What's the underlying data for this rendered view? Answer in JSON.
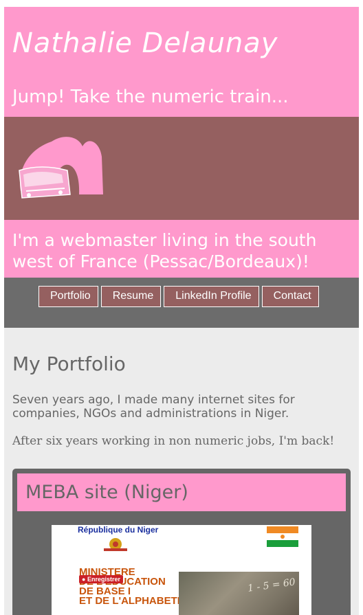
{
  "header": {
    "site_name": "Nathalie Delaunay",
    "tagline": "Jump! Take the numeric train..."
  },
  "banner": {
    "logo_icon": "train-tunnel-icon"
  },
  "intro": {
    "text": "I'm a webmaster living in the south west of France (Pessac/Bordeaux)!"
  },
  "nav": {
    "items": [
      {
        "label": "Portfolio"
      },
      {
        "label": "Resume"
      },
      {
        "label": "LinkedIn Profile"
      },
      {
        "label": "Contact"
      }
    ]
  },
  "main": {
    "title": "My Portfolio",
    "paragraph_1": "Seven years ago, I made many internet sites for companies, NGOs and administrations in Niger.",
    "paragraph_2": "After six years working in non numeric jobs, I'm back!"
  },
  "card": {
    "title": "MEBA site (Niger)",
    "screenshot": {
      "country": "République du Niger",
      "ministry_line_1": "MINISTERE",
      "ministry_line_2": "DE L'EDUCATION",
      "ministry_line_3": "DE BASE I",
      "ministry_line_4": "ET DE L'ALPHABETISATION",
      "pin_label": "Enregistrer",
      "board_text": "1 - 5 = 60"
    }
  },
  "colors": {
    "pink": "#ff99cc",
    "mauve": "#956060",
    "gray": "#6c6c6c",
    "text_gray": "#666666"
  }
}
